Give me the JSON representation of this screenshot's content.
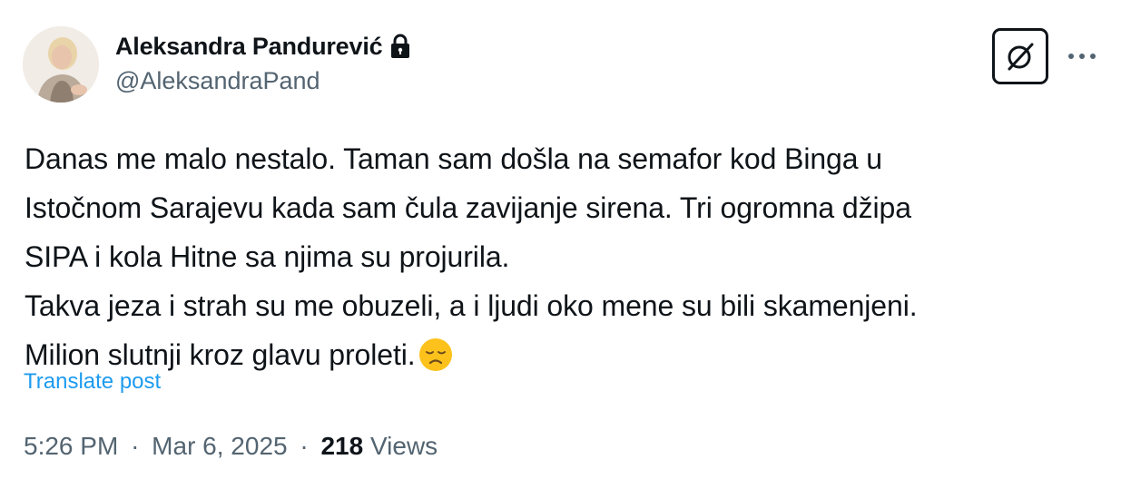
{
  "author": {
    "display_name": "Aleksandra Pandurević",
    "handle": "@AleksandraPand",
    "protected": true
  },
  "header_actions": {
    "grok_icon": "slashed-circle-icon",
    "more_icon": "more-dots-icon"
  },
  "post": {
    "lines": [
      "Danas me malo nestalo. Taman sam došla na semafor kod Binga u",
      "Istočnom Sarajevu kada sam čula zavijanje sirena. Tri ogromna džipa",
      "SIPA i kola Hitne sa njima su projurila.",
      "Takva jeza i strah su me obuzeli, a i ljudi oko mene su bili skamenjeni.",
      "Milion slutnji kroz glavu proleti."
    ],
    "emoji": "disappointed-face"
  },
  "translate_label": "Translate post",
  "meta": {
    "time": "5:26 PM",
    "separator": "·",
    "date": "Mar 6, 2025",
    "views_count": "218",
    "views_label": "Views"
  },
  "colors": {
    "text": "#0f1419",
    "secondary": "#536471",
    "link": "#1d9bf0"
  }
}
